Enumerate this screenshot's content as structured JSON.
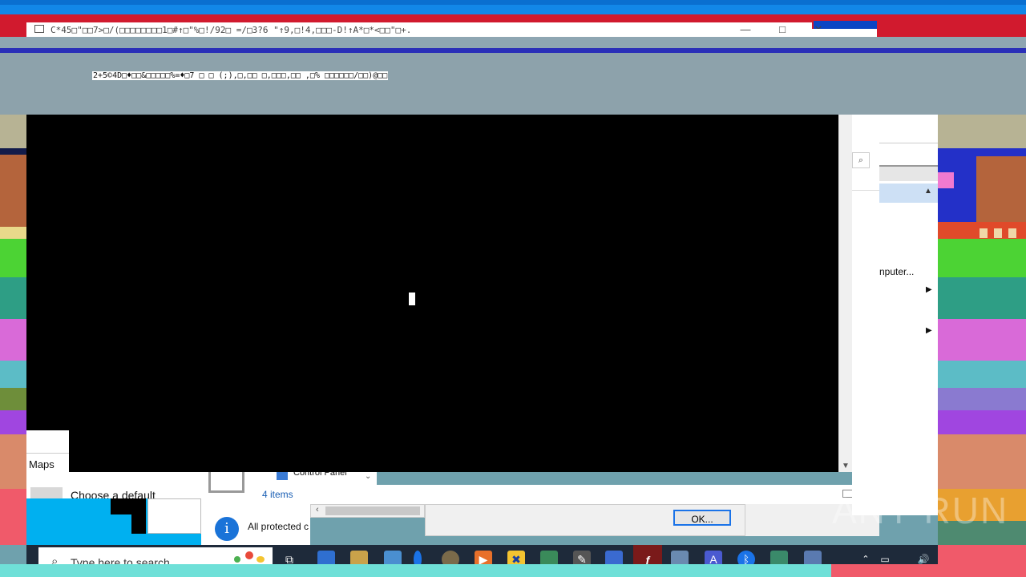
{
  "console_window": {
    "title": "C*45□\"□□7>□/(□□□□□□□□1□#↑□\"%□!/92□ =/□3?6 \"↑9,□!4,□□□-D!↑A*□*<□□\"□+.",
    "minimize": "—",
    "maximize": "□",
    "close": "✕",
    "garbled_line": "2+5©4D□♦□□&□□□□□%=♦□7 □ □ (;),□,□□ □,□□□,□□ ,□% □□□□□□/□□)@□□"
  },
  "background_windows": {
    "maps_label": "Maps",
    "choose_default": "Choose a default",
    "control_panel": "Control Panel",
    "items_count": "4 items",
    "protected_text": "All protected c",
    "computer_menu": "nputer...",
    "ok_button": "OK..."
  },
  "taskbar": {
    "search_placeholder": "Type here to search"
  },
  "watermark": "ANY RUN",
  "colors": {
    "console_bg": "#000000",
    "taskbar_bg": "#1e2a3a",
    "accent": "#1a73e8"
  }
}
